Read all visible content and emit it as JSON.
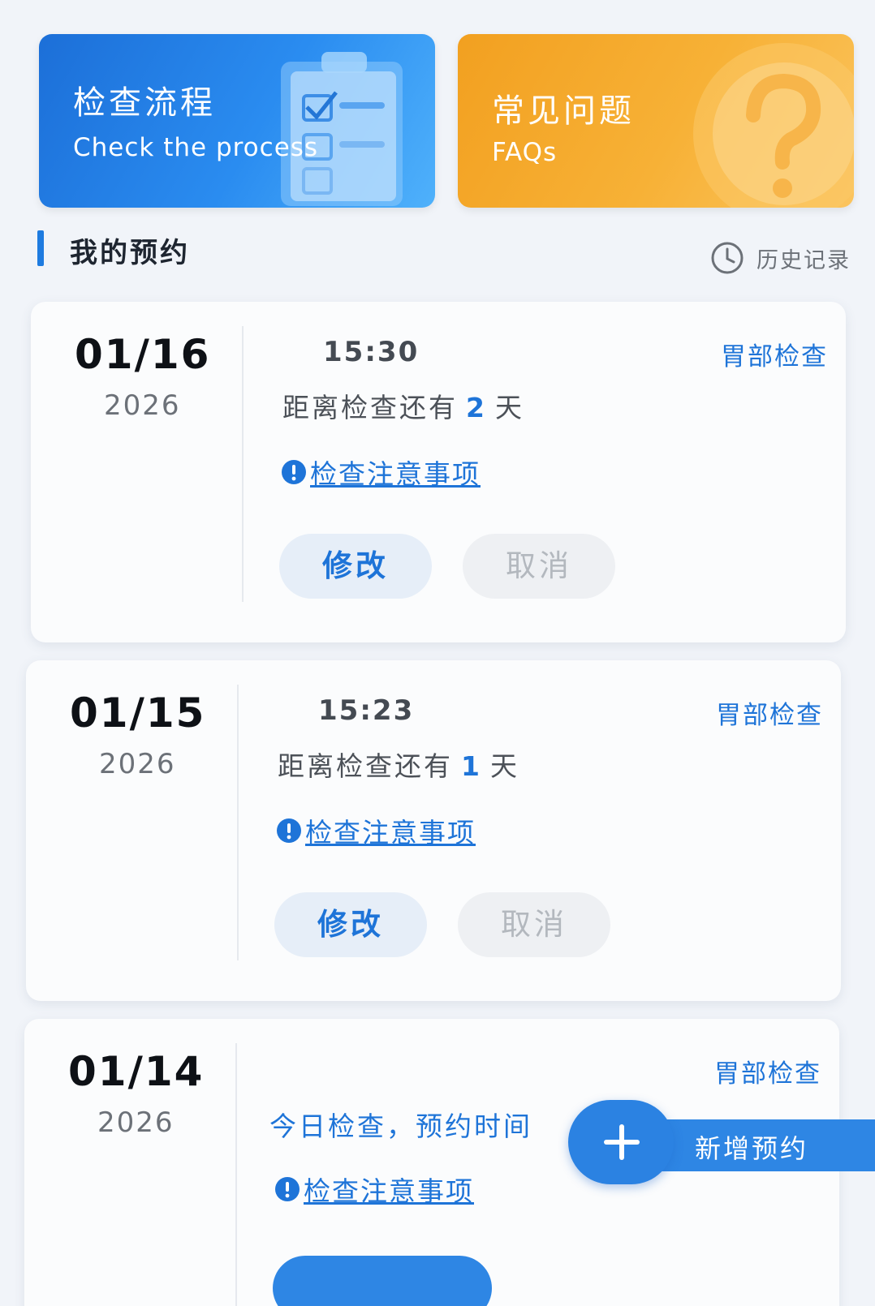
{
  "banners": {
    "process": {
      "title": "检查流程",
      "subtitle": "Check the process"
    },
    "faq": {
      "title": "常见问题",
      "subtitle": "FAQs"
    }
  },
  "section": {
    "title": "我的预约",
    "history_label": "历史记录"
  },
  "appointments": [
    {
      "date": "01/16",
      "year": "2026",
      "time": "15:30",
      "exam_type": "胃部检查",
      "countdown_prefix": "距离检查还有",
      "countdown_days": "2",
      "countdown_suffix": "天",
      "notice": "检查注意事项",
      "edit_label": "修改",
      "cancel_label": "取消"
    },
    {
      "date": "01/15",
      "year": "2026",
      "time": "15:23",
      "exam_type": "胃部检查",
      "countdown_prefix": "距离检查还有",
      "countdown_days": "1",
      "countdown_suffix": "天",
      "notice": "检查注意事项",
      "edit_label": "修改",
      "cancel_label": "取消"
    },
    {
      "date": "01/14",
      "year": "2026",
      "exam_type": "胃部检查",
      "today_text": "今日检查，预约时间",
      "notice": "检查注意事项"
    }
  ],
  "fab": {
    "label": "新增预约"
  },
  "colors": {
    "primary": "#1e74d8",
    "orange": "#f2a020",
    "background": "#f1f4f9"
  }
}
